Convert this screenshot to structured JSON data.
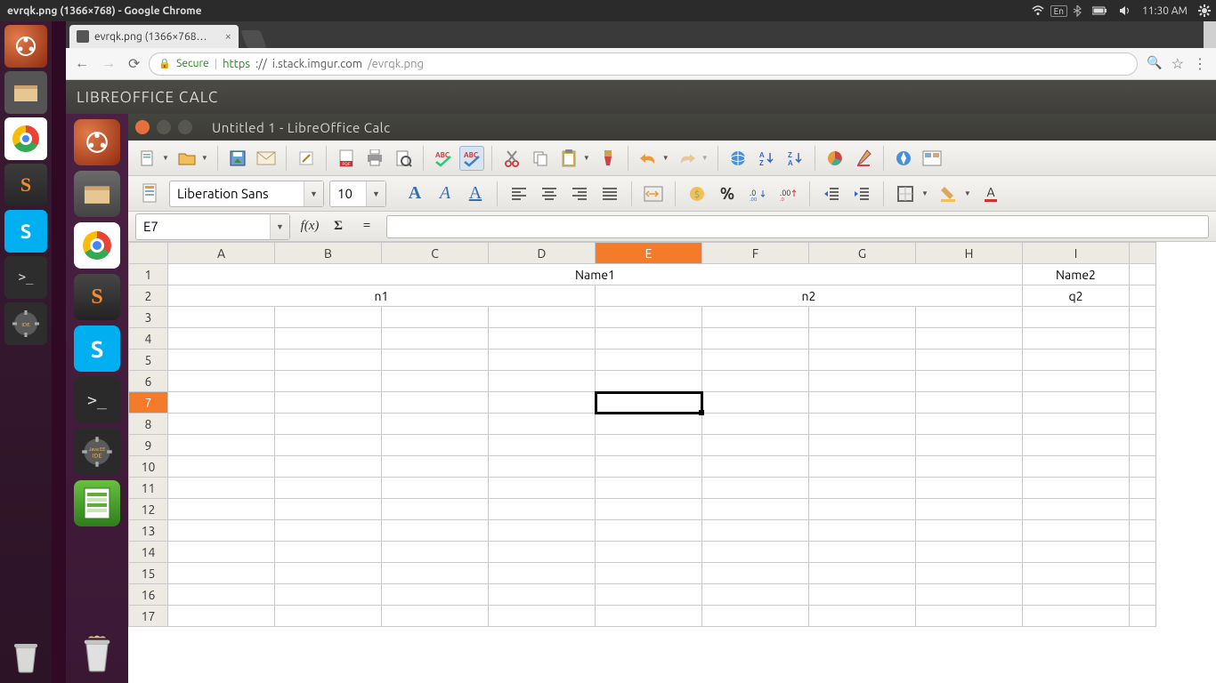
{
  "ubuntu_panel": {
    "window_title": "evrqk.png (1366×768) - Google Chrome",
    "lang": "En",
    "time": "11:30 AM"
  },
  "browser": {
    "tab_label": "evrqk.png (1366×768…",
    "secure_label": "Secure",
    "url_scheme": "https",
    "url_host": "i.stack.imgur.com",
    "url_path": "/evrqk.png"
  },
  "inner_titlebar": "LIBREOFFICE CALC",
  "calc": {
    "title": "Untitled 1 - LibreOffice Calc",
    "font_name": "Liberation Sans",
    "font_size": "10",
    "name_box": "E7",
    "formula": ""
  },
  "grid": {
    "columns": [
      "A",
      "B",
      "C",
      "D",
      "E",
      "F",
      "G",
      "H",
      "I"
    ],
    "active_col": "E",
    "active_row": 7,
    "row_count": 17,
    "cells": {
      "row1": {
        "A_to_H": "Name1",
        "I": "Name2"
      },
      "row2": {
        "A_to_D": "n1",
        "E_to_H": "n2",
        "I": "q2"
      }
    }
  }
}
